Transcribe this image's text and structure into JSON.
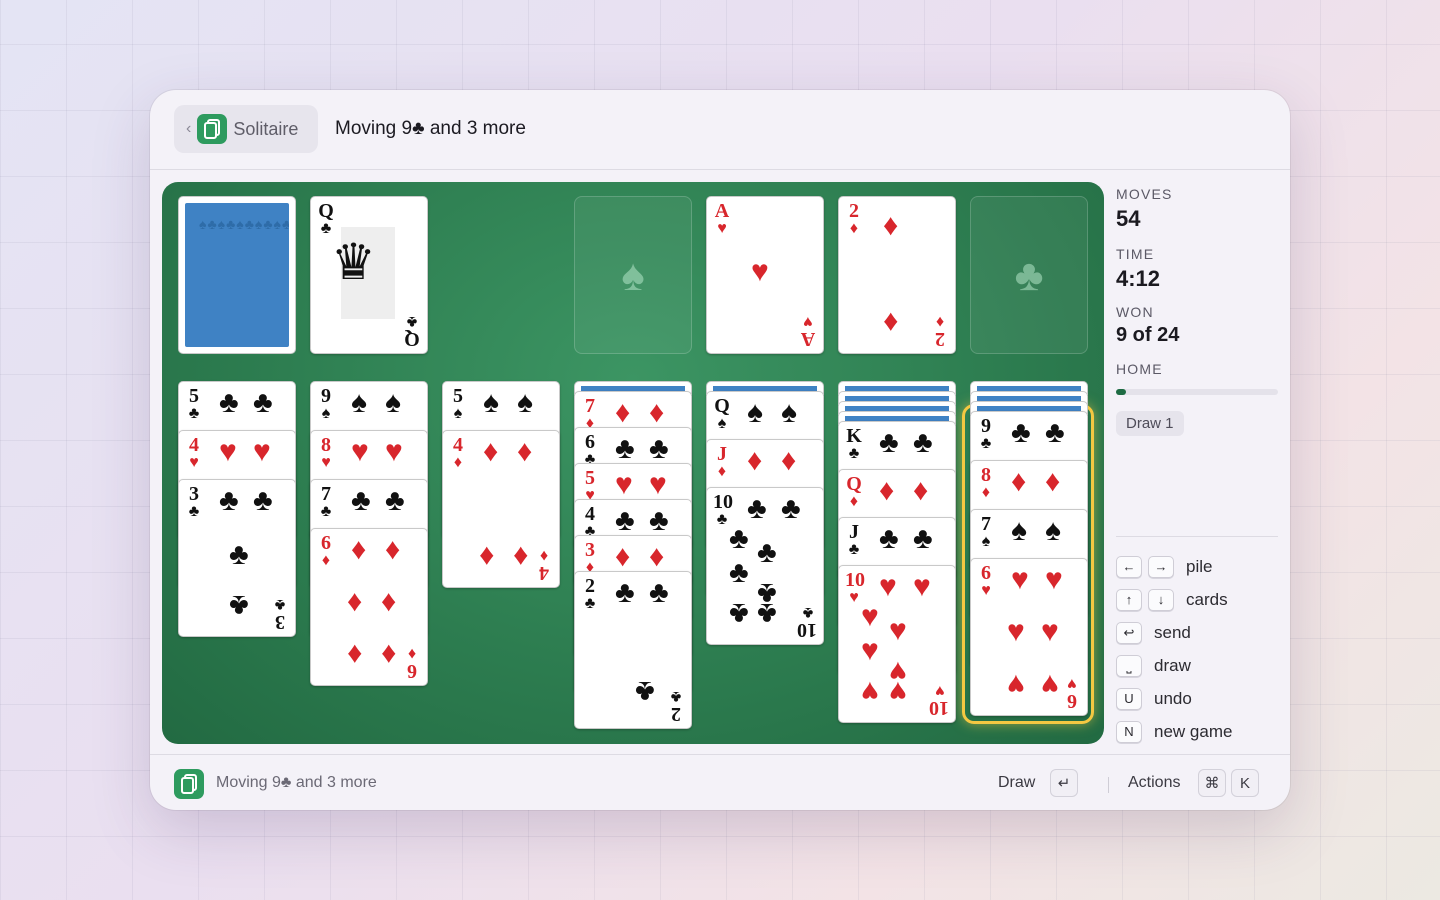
{
  "header": {
    "back_glyph": "‹",
    "app_name": "Solitaire",
    "title": "Moving 9♣ and 3 more"
  },
  "game": {
    "stock": {
      "face_down": true,
      "pattern": "♠♣♠♣"
    },
    "waste": {
      "rank": "Q",
      "suit": "♣",
      "color": "black"
    },
    "foundations": [
      {
        "empty": true,
        "suit_hint": "♠"
      },
      {
        "rank": "A",
        "suit": "♥",
        "color": "red"
      },
      {
        "rank": "2",
        "suit": "♦",
        "color": "red"
      },
      {
        "empty": true,
        "suit_hint": "♣"
      }
    ],
    "tableau": [
      {
        "hidden": 0,
        "cards": [
          {
            "rank": "5",
            "suit": "♣",
            "color": "black"
          },
          {
            "rank": "4",
            "suit": "♥",
            "color": "red"
          },
          {
            "rank": "3",
            "suit": "♣",
            "color": "black"
          }
        ]
      },
      {
        "hidden": 0,
        "cards": [
          {
            "rank": "9",
            "suit": "♠",
            "color": "black"
          },
          {
            "rank": "8",
            "suit": "♥",
            "color": "red"
          },
          {
            "rank": "7",
            "suit": "♣",
            "color": "black"
          },
          {
            "rank": "6",
            "suit": "♦",
            "color": "red"
          }
        ]
      },
      {
        "hidden": 0,
        "cards": [
          {
            "rank": "5",
            "suit": "♠",
            "color": "black"
          },
          {
            "rank": "4",
            "suit": "♦",
            "color": "red"
          }
        ]
      },
      {
        "hidden": 1,
        "cards": [
          {
            "rank": "7",
            "suit": "♦",
            "color": "red"
          },
          {
            "rank": "6",
            "suit": "♣",
            "color": "black"
          },
          {
            "rank": "5",
            "suit": "♥",
            "color": "red"
          },
          {
            "rank": "4",
            "suit": "♣",
            "color": "black"
          },
          {
            "rank": "3",
            "suit": "♦",
            "color": "red"
          },
          {
            "rank": "2",
            "suit": "♣",
            "color": "black"
          }
        ]
      },
      {
        "hidden": 1,
        "cards": [
          {
            "rank": "Q",
            "suit": "♠",
            "color": "black"
          },
          {
            "rank": "J",
            "suit": "♦",
            "color": "red"
          },
          {
            "rank": "10",
            "suit": "♣",
            "color": "black"
          }
        ]
      },
      {
        "hidden": 4,
        "cards": [
          {
            "rank": "K",
            "suit": "♣",
            "color": "black"
          },
          {
            "rank": "Q",
            "suit": "♦",
            "color": "red"
          },
          {
            "rank": "J",
            "suit": "♣",
            "color": "black"
          },
          {
            "rank": "10",
            "suit": "♥",
            "color": "red"
          }
        ]
      },
      {
        "hidden": 3,
        "selected_from": 0,
        "cards": [
          {
            "rank": "9",
            "suit": "♣",
            "color": "black"
          },
          {
            "rank": "8",
            "suit": "♦",
            "color": "red"
          },
          {
            "rank": "7",
            "suit": "♠",
            "color": "black"
          },
          {
            "rank": "6",
            "suit": "♥",
            "color": "red"
          }
        ]
      }
    ]
  },
  "stats": {
    "moves_label": "MOVES",
    "moves": "54",
    "time_label": "TIME",
    "time": "4:12",
    "won_label": "WON",
    "won": "9 of 24",
    "home_label": "HOME",
    "home_progress": 0.06,
    "draw_mode": "Draw 1"
  },
  "shortcuts": [
    {
      "keys": [
        "←",
        "→"
      ],
      "label": "pile"
    },
    {
      "keys": [
        "↑",
        "↓"
      ],
      "label": "cards"
    },
    {
      "keys": [
        "↩"
      ],
      "label": "send"
    },
    {
      "keys": [
        "⎵"
      ],
      "label": "draw"
    },
    {
      "keys": [
        "U"
      ],
      "label": "undo"
    },
    {
      "keys": [
        "N"
      ],
      "label": "new game"
    }
  ],
  "footer": {
    "status": "Moving 9♣ and 3 more",
    "draw_label": "Draw",
    "draw_key": "↵",
    "actions_label": "Actions",
    "actions_keys": [
      "⌘",
      "K"
    ]
  },
  "colors": {
    "table": "#2d7d50",
    "selection": "#f4c842",
    "card_back": "#3f82c4",
    "red": "#d8262c"
  }
}
